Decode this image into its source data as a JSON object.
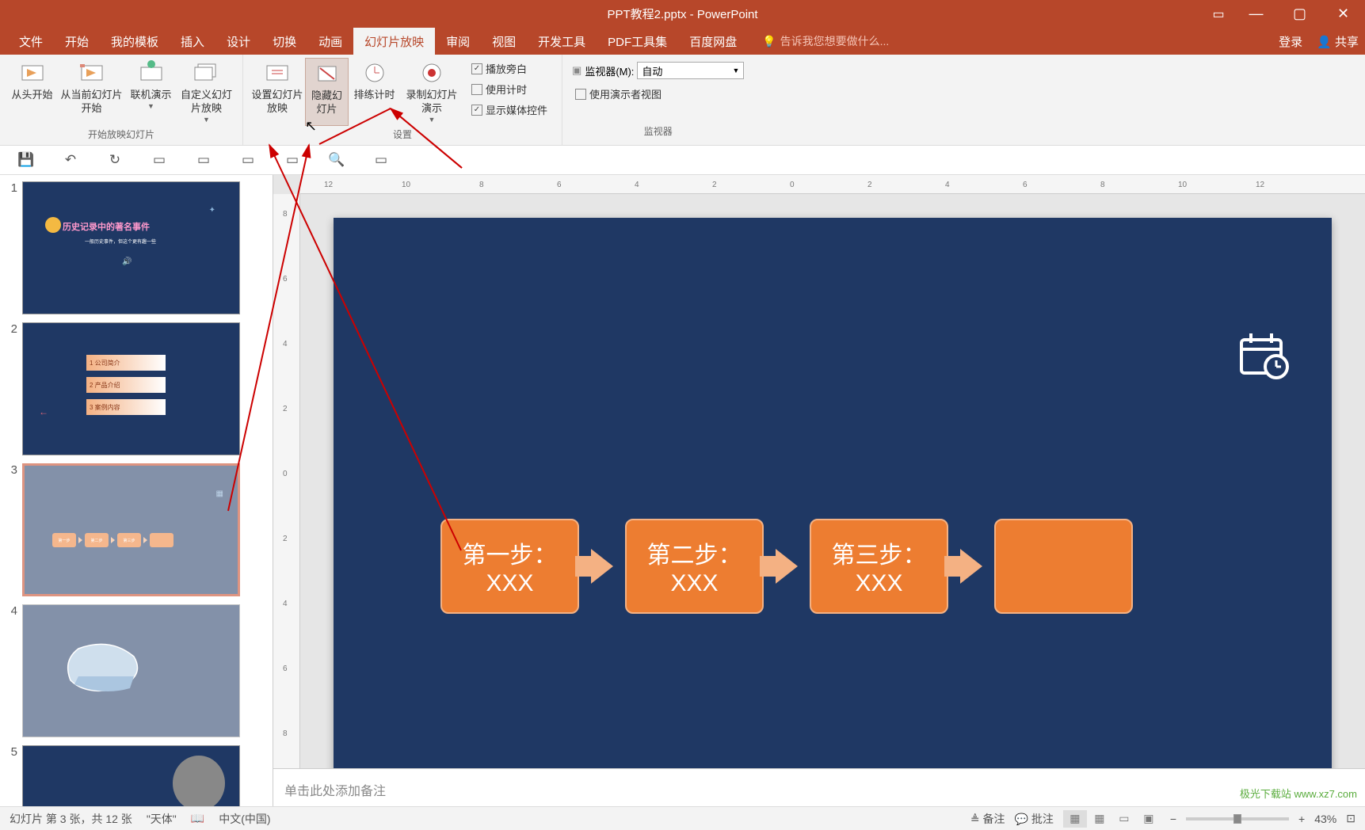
{
  "title": "PPT教程2.pptx - PowerPoint",
  "tabs": {
    "file": "文件",
    "home": "开始",
    "mytpl": "我的模板",
    "insert": "插入",
    "design": "设计",
    "trans": "切换",
    "anim": "动画",
    "slideshow": "幻灯片放映",
    "review": "审阅",
    "view": "视图",
    "devtools": "开发工具",
    "pdftools": "PDF工具集",
    "baidu": "百度网盘",
    "tellme": "告诉我您想要做什么...",
    "login": "登录",
    "share": "共享"
  },
  "ribbon": {
    "group_start": "开始放映幻灯片",
    "group_setup": "设置",
    "group_monitor": "监视器",
    "from_begin": "从头开始",
    "from_current": "从当前幻灯片开始",
    "online": "联机演示",
    "custom": "自定义幻灯片放映",
    "setup": "设置幻灯片放映",
    "hide": "隐藏幻灯片",
    "rehearse": "排练计时",
    "record": "录制幻灯片演示",
    "play_narr": "播放旁白",
    "use_timing": "使用计时",
    "show_media": "显示媒体控件",
    "monitor_label": "监视器(M):",
    "monitor_sel": "自动",
    "presenter": "使用演示者视图"
  },
  "notes": "单击此处添加备注",
  "status": {
    "slide": "幻灯片 第 3 张，共 12 张",
    "theme": "\"天体\"",
    "lang": "中文(中国)",
    "notes": "备注",
    "comments": "批注",
    "zoom": "43%",
    "fit": "⊡"
  },
  "slide": {
    "step1": "第一步：",
    "step2": "第二步：",
    "step3": "第三步：",
    "sub": "XXX"
  },
  "thumbs": {
    "t1_title": "历史记录中的著名事件",
    "t1_sub": "一般历史事件，但这个更有趣一些",
    "t2_1": "1 公司简介",
    "t2_2": "2 产品介绍",
    "t2_3": "3 案例内容",
    "n1": "1",
    "n2": "2",
    "n3": "3",
    "n4": "4",
    "n5": "5"
  },
  "ruler": {
    "marks": [
      "12",
      "10",
      "8",
      "6",
      "4",
      "2",
      "0",
      "2",
      "4",
      "6",
      "8",
      "10",
      "12"
    ]
  },
  "watermark": "极光下载站 www.xz7.com"
}
